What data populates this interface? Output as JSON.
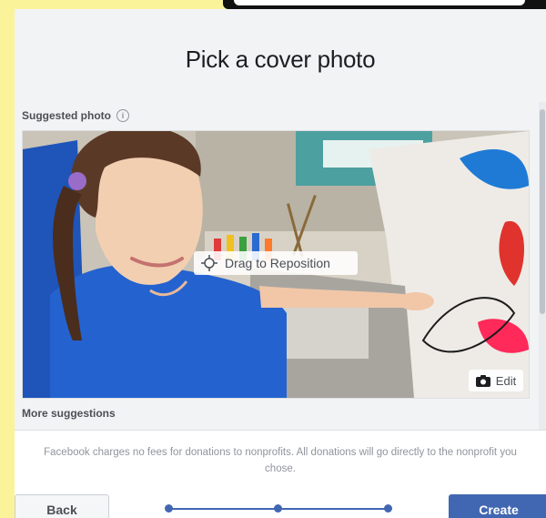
{
  "dialog": {
    "title": "Pick a cover photo",
    "suggested_label": "Suggested photo",
    "info_glyph": "i",
    "drag_label": "Drag to Reposition",
    "edit_label": "Edit",
    "more_label": "More suggestions",
    "notice": "Facebook charges no fees for donations to nonprofits. All donations will go directly to the nonprofit you chose.",
    "back_label": "Back",
    "create_label": "Create",
    "stepper": {
      "steps": 3,
      "current_step": 3
    }
  },
  "icons": {
    "info": "info-icon",
    "drag": "move-arrows-icon",
    "edit": "camera-icon"
  },
  "colors": {
    "accent": "#4267b2",
    "background": "#fbf39a",
    "dialog_bg": "#f2f3f5",
    "muted_text": "#90949c"
  }
}
